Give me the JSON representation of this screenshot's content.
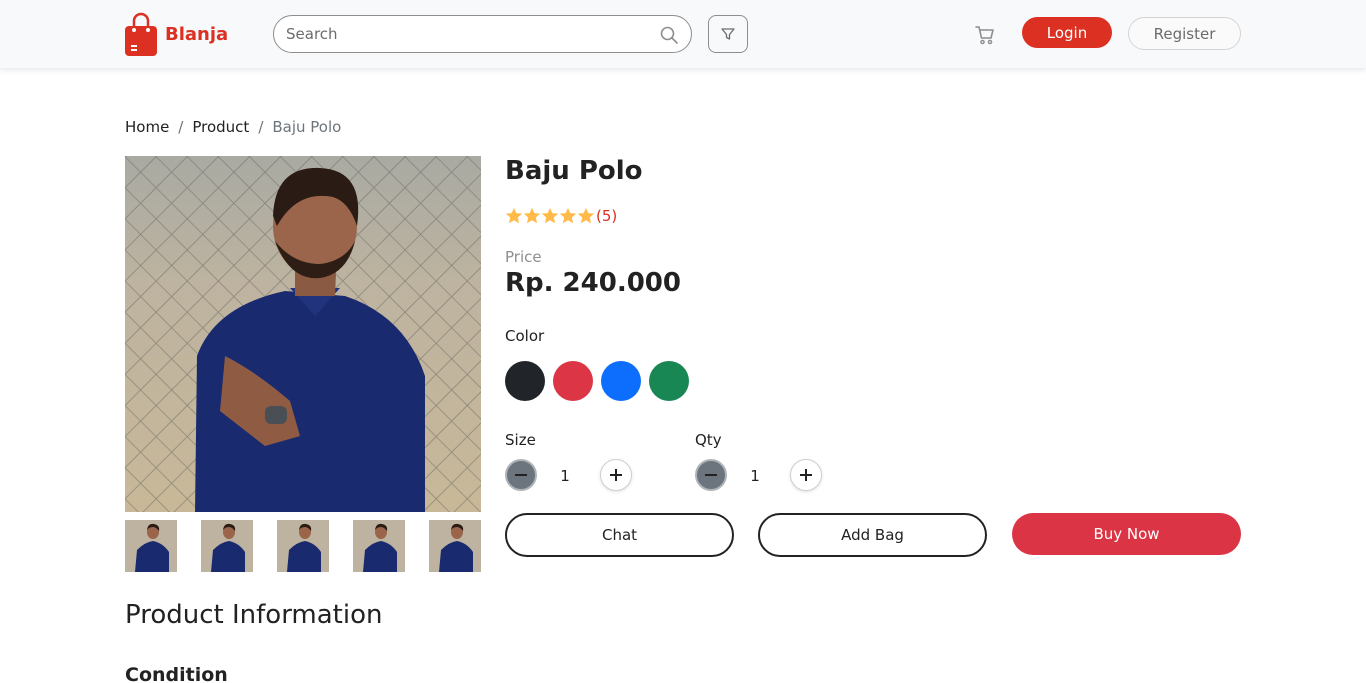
{
  "navbar": {
    "brand": "Blanja",
    "search_placeholder": "Search",
    "login_label": "Login",
    "register_label": "Register",
    "icons": [
      "shopping-bag-icon",
      "search-icon",
      "filter-icon",
      "cart-icon"
    ]
  },
  "breadcrumb": {
    "items": [
      "Home",
      "Product",
      "Baju Polo"
    ]
  },
  "product": {
    "title": "Baju Polo",
    "rating": 5,
    "rating_count": "(5)",
    "price_label": "Price",
    "price": "Rp. 240.000",
    "color_label": "Color",
    "colors": [
      "#212529",
      "#dc3545",
      "#0d6efd",
      "#198754"
    ],
    "size_label": "Size",
    "size_value": "1",
    "qty_label": "Qty",
    "qty_value": "1",
    "thumbnail_count": 5
  },
  "actions": {
    "chat": "Chat",
    "add_bag": "Add Bag",
    "buy_now": "Buy Now"
  },
  "info": {
    "section_title": "Product Information",
    "condition_title": "Condition"
  },
  "colors": {
    "brand_red": "#db3022",
    "buy_red": "#db3545",
    "star": "#ffba49"
  }
}
